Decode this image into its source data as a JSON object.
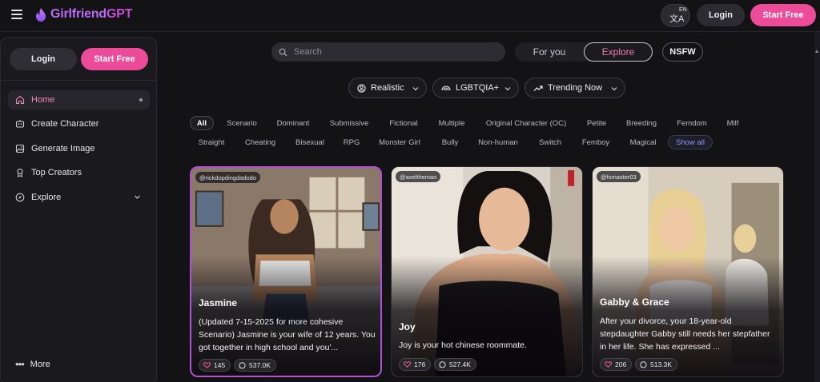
{
  "brand": {
    "name": "GirlfriendGPT",
    "accent": "#ec4b99",
    "logo_color": "#b96cf3"
  },
  "topbar": {
    "lang_code": "EN",
    "login_label": "Login",
    "start_label": "Start Free"
  },
  "sidebar": {
    "login_label": "Login",
    "start_label": "Start Free",
    "items": [
      {
        "label": "Home",
        "icon": "home-icon",
        "active": true
      },
      {
        "label": "Create Character",
        "icon": "create-character-icon"
      },
      {
        "label": "Generate Image",
        "icon": "image-icon"
      },
      {
        "label": "Top Creators",
        "icon": "award-icon"
      },
      {
        "label": "Explore",
        "icon": "compass-icon"
      }
    ],
    "more_label": "More"
  },
  "search": {
    "placeholder": "Search"
  },
  "tabs": {
    "for_you": "For you",
    "explore": "Explore",
    "active": "Explore"
  },
  "nsfw_label": "NSFW",
  "filters": [
    {
      "label": "Realistic",
      "icon": "face-icon"
    },
    {
      "label": "LGBTQIA+",
      "icon": "rainbow-icon"
    },
    {
      "label": "Trending Now",
      "icon": "trending-icon"
    }
  ],
  "tags": {
    "row1": [
      "All",
      "Scenario",
      "Dominant",
      "Submissive",
      "Fictional",
      "Multiple",
      "Original Character (OC)",
      "Petite",
      "Breeding",
      "Femdom",
      "Milf"
    ],
    "row2": [
      "Straight",
      "Cheating",
      "Bisexual",
      "RPG",
      "Monster Girl",
      "Bully",
      "Non-human",
      "Switch",
      "Femboy",
      "Magical"
    ],
    "show_all": "Show all",
    "active": "All"
  },
  "cards": [
    {
      "handle": "@rickdopdingdadodo",
      "name": "Jasmine",
      "description": "(Updated 7-15-2025 for more cohesive Scenario) Jasmine is your wife of 12 years. You got together in high school and you'...",
      "likes": "145",
      "messages": "537.0K"
    },
    {
      "handle": "@axeltheman",
      "name": "Joy",
      "description": "Joy is your hot chinese roommate.",
      "likes": "176",
      "messages": "527.4K"
    },
    {
      "handle": "@fsmaster03",
      "name": "Gabby & Grace",
      "description": "After your divorce, your 18-year-old stepdaughter Gabby still needs her stepfather in her life. She has expressed ...",
      "likes": "206",
      "messages": "513.3K"
    }
  ]
}
